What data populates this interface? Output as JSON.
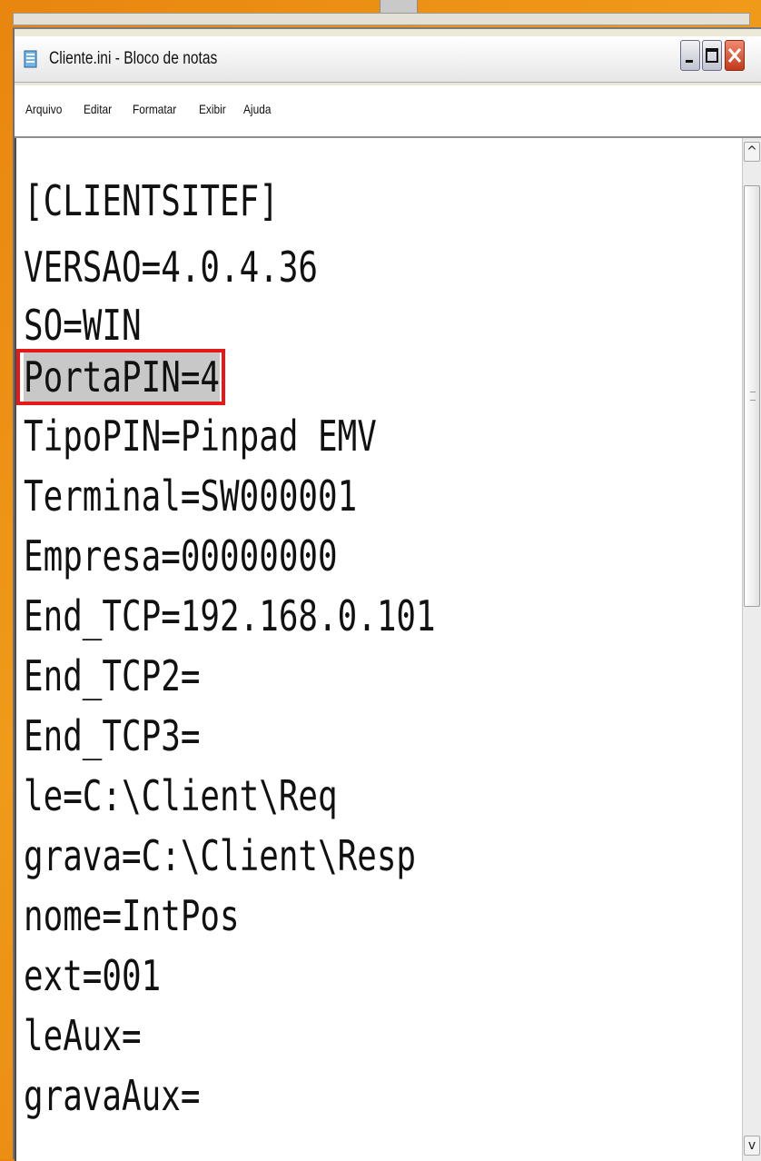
{
  "window": {
    "title": "Cliente.ini - Bloco de notas"
  },
  "menu": {
    "items": [
      "Arquivo",
      "Editar",
      "Formatar",
      "Exibir",
      "Ajuda"
    ]
  },
  "editor": {
    "lines": [
      "[CLIENTSITEF]",
      "VERSAO=4.0.4.36",
      "SO=WIN",
      "PortaPIN=4",
      "TipoPIN=Pinpad EMV",
      "Terminal=SW000001",
      "Empresa=00000000",
      "End_TCP=192.168.0.101",
      "End_TCP2=",
      "End_TCP3=",
      "le=C:\\Client\\Req",
      "grava=C:\\Client\\Resp",
      "nome=IntPos",
      "ext=001",
      "leAux=",
      "gravaAux="
    ],
    "highlighted_line": "PortaPIN=4"
  },
  "scrollbar": {
    "up_arrow": "^",
    "down_arrow": "v"
  },
  "colors": {
    "highlight_box": "#e21a1a",
    "selection": "#c8c8c8",
    "background": "#e8860f"
  }
}
